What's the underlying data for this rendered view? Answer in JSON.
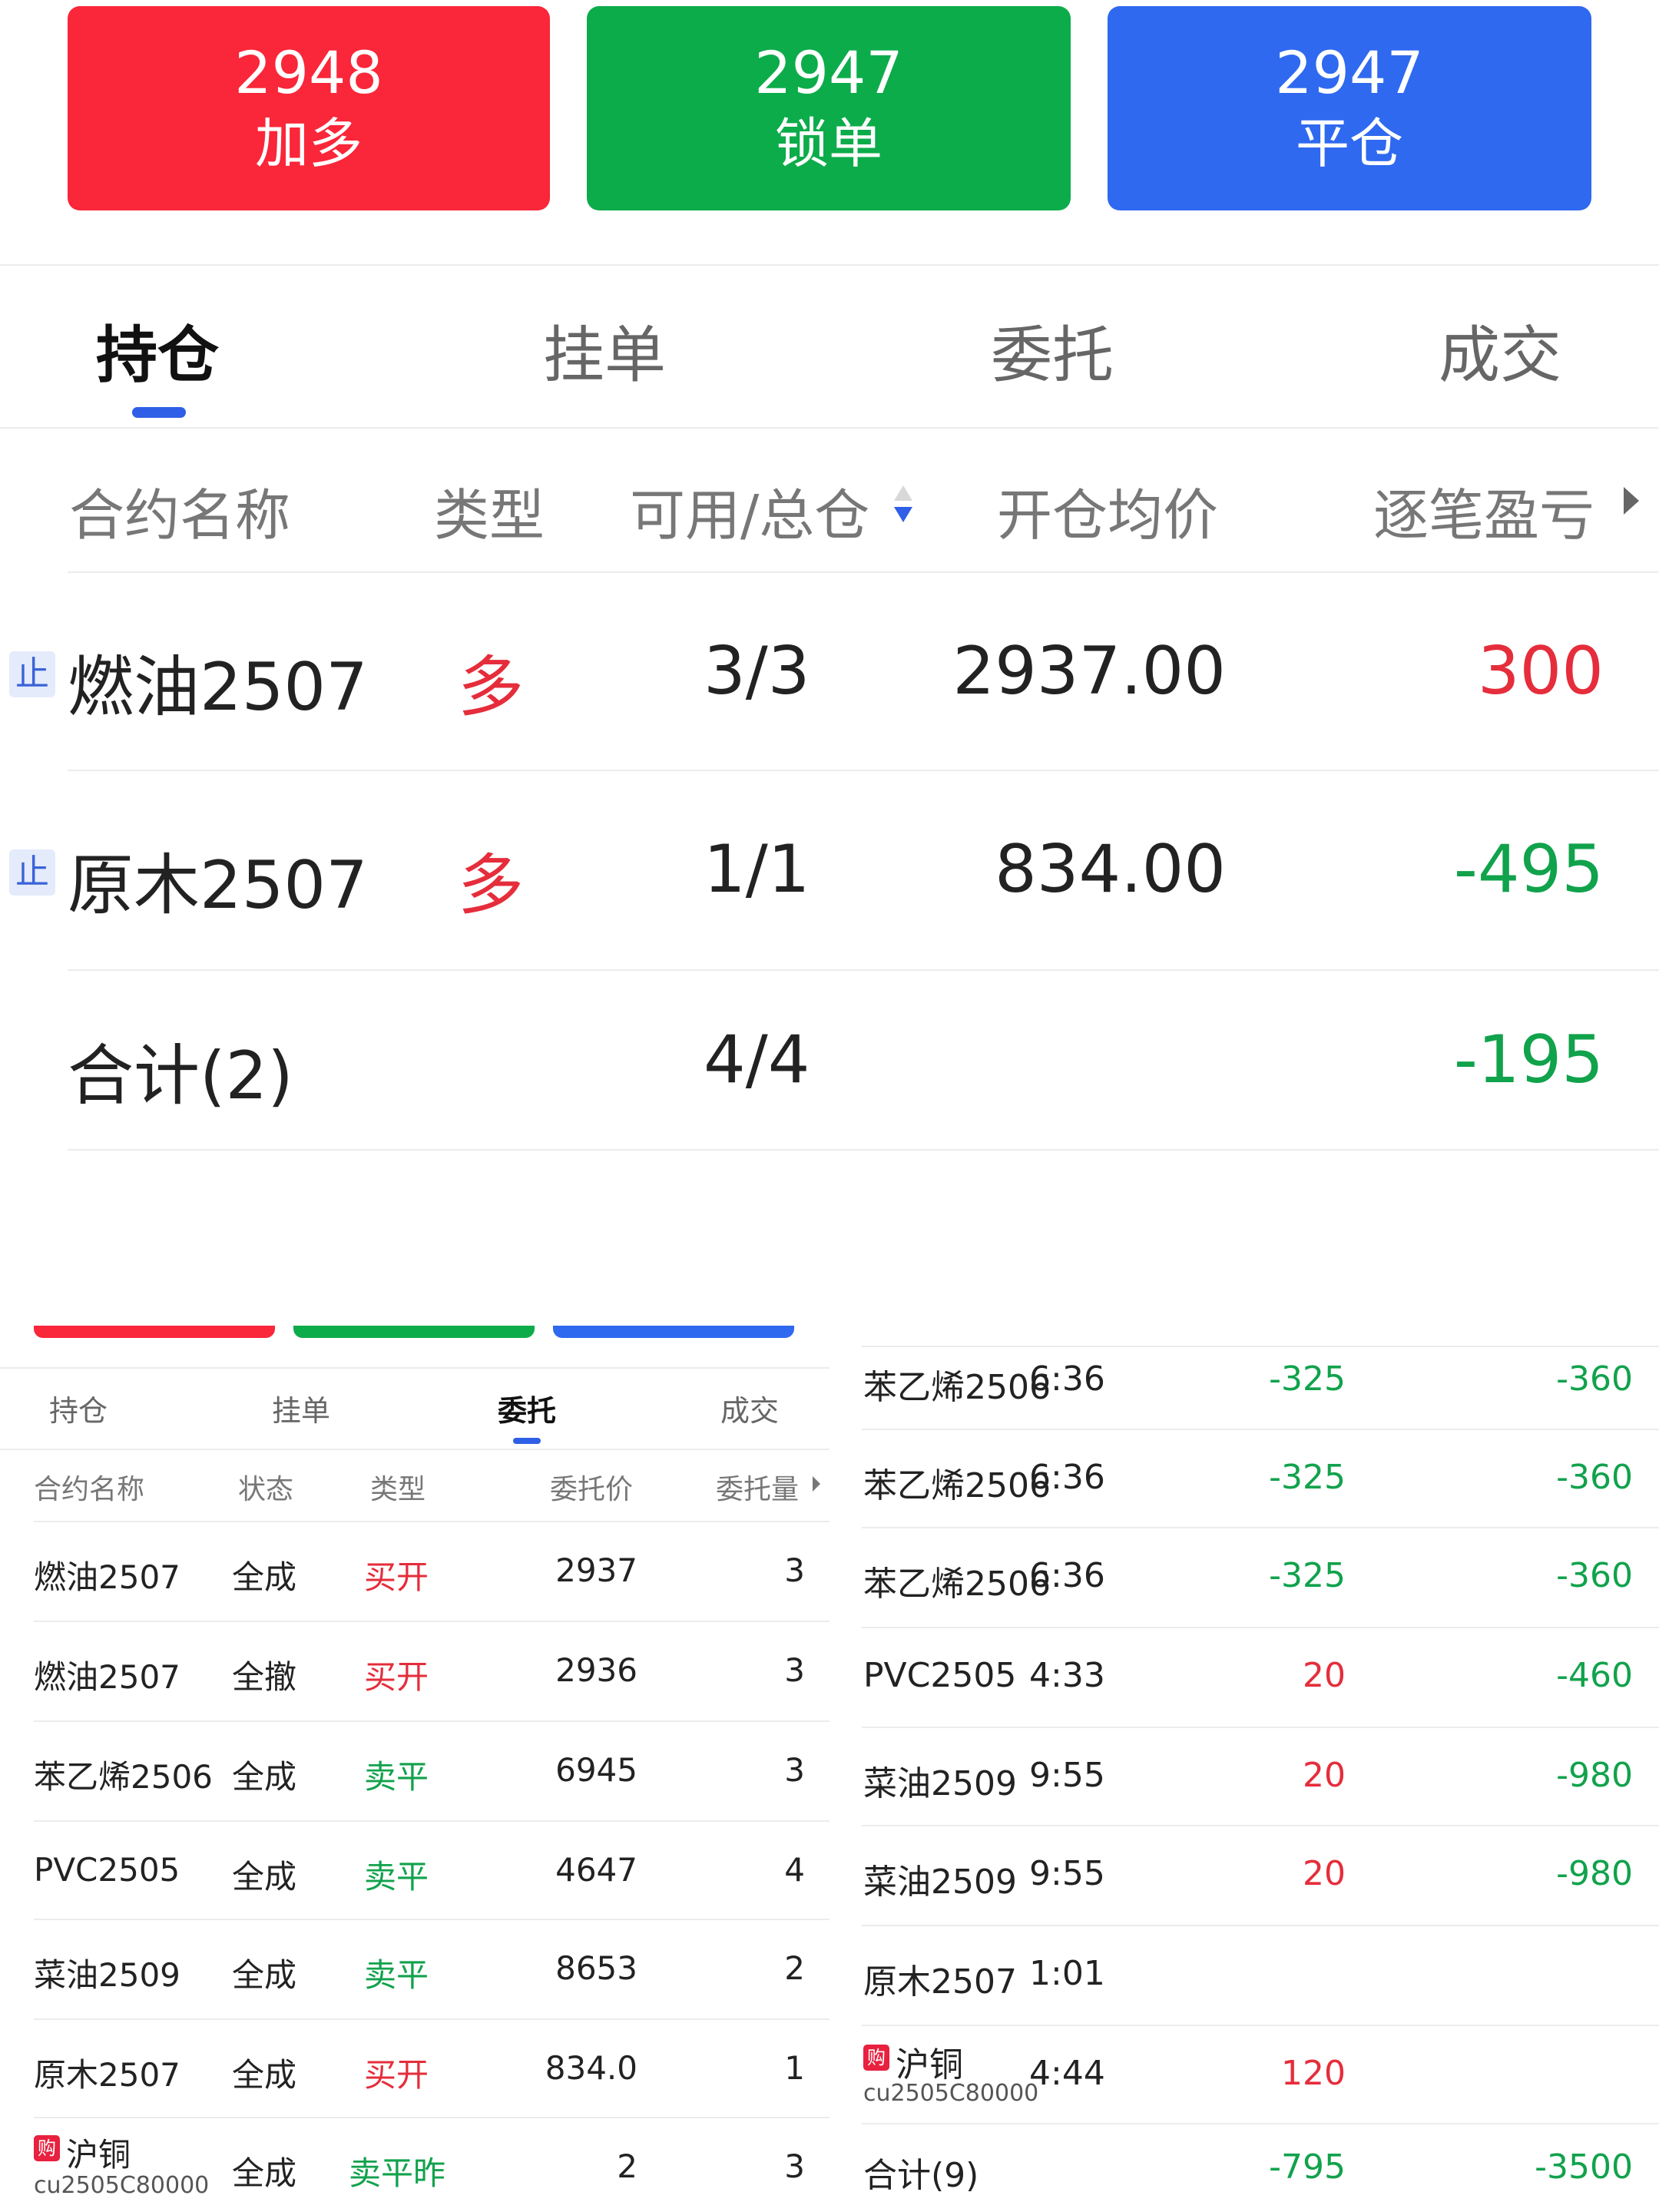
{
  "colors": {
    "red": "#fa2639",
    "green": "#0cac4a",
    "blue": "#2f69f0",
    "profit_red": "#e52d3b",
    "loss_green": "#11a24c",
    "tab_indicator": "#2f5fe6"
  },
  "actions": [
    {
      "price": "2948",
      "label": "加多",
      "color": "red"
    },
    {
      "price": "2947",
      "label": "锁单",
      "color": "green"
    },
    {
      "price": "2947",
      "label": "平仓",
      "color": "blue"
    }
  ],
  "positions_panel": {
    "tabs": [
      "持仓",
      "挂单",
      "委托",
      "成交"
    ],
    "active_tab": "持仓",
    "columns": [
      "合约名称",
      "类型",
      "可用/总仓",
      "开仓均价",
      "逐笔盈亏"
    ],
    "sort_icon": "sort-updown-icon",
    "more_icon": "caret-right-icon",
    "rows": [
      {
        "badge": "止",
        "name": "燃油2507",
        "type": "多",
        "qty": "3/3",
        "avg_price": "2937.00",
        "pnl": "300"
      },
      {
        "badge": "止",
        "name": "原木2507",
        "type": "多",
        "qty": "1/1",
        "avg_price": "834.00",
        "pnl": "-495"
      }
    ],
    "total": {
      "label": "合计(2)",
      "qty": "4/4",
      "pnl": "-195"
    }
  },
  "orders_panel": {
    "tabs": [
      "持仓",
      "挂单",
      "委托",
      "成交"
    ],
    "active_tab": "委托",
    "columns": [
      "合约名称",
      "状态",
      "类型",
      "委托价",
      "委托量"
    ],
    "rows": [
      {
        "name": "燃油2507",
        "status": "全成",
        "type": "买开",
        "price": "2937",
        "qty": "3"
      },
      {
        "name": "燃油2507",
        "status": "全撤",
        "type": "买开",
        "price": "2936",
        "qty": "3"
      },
      {
        "name": "苯乙烯2506",
        "status": "全成",
        "type": "卖平",
        "price": "6945",
        "qty": "3"
      },
      {
        "name": "PVC2505",
        "status": "全成",
        "type": "卖平",
        "price": "4647",
        "qty": "4"
      },
      {
        "name": "菜油2509",
        "status": "全成",
        "type": "卖平",
        "price": "8653",
        "qty": "2"
      },
      {
        "name": "原木2507",
        "status": "全成",
        "type": "买开",
        "price": "834.0",
        "qty": "1"
      },
      {
        "badge": "购",
        "name": "沪铜",
        "code": "cu2505C80000",
        "status": "全成",
        "type": "卖平昨",
        "price": "2",
        "qty": "3"
      }
    ]
  },
  "trades_panel": {
    "rows": [
      {
        "name": "苯乙烯2506",
        "time": "6:36",
        "pnl": "-325",
        "total": "-360"
      },
      {
        "name": "苯乙烯2506",
        "time": "6:36",
        "pnl": "-325",
        "total": "-360"
      },
      {
        "name": "苯乙烯2506",
        "time": "6:36",
        "pnl": "-325",
        "total": "-360"
      },
      {
        "name": "PVC2505",
        "time": "4:33",
        "pnl": "20",
        "total": "-460"
      },
      {
        "name": "菜油2509",
        "time": "9:55",
        "pnl": "20",
        "total": "-980"
      },
      {
        "name": "菜油2509",
        "time": "9:55",
        "pnl": "20",
        "total": "-980"
      },
      {
        "name": "原木2507",
        "time": "1:01",
        "pnl": "",
        "total": ""
      },
      {
        "badge": "购",
        "name": "沪铜",
        "code": "cu2505C80000",
        "time": "4:44",
        "pnl": "120",
        "total": ""
      }
    ],
    "total": {
      "label": "合计(9)",
      "pnl": "-795",
      "total": "-3500"
    }
  }
}
